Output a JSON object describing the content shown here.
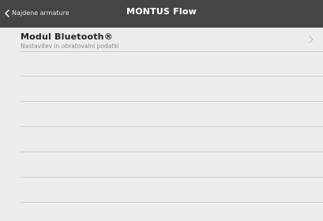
{
  "header": {
    "back_label": "Najdene armature",
    "title": "MONTUS Flow"
  },
  "list": {
    "items": [
      {
        "title": "Modul Bluetooth®",
        "subtitle": "Nastavitev in obratovalni podatki"
      }
    ],
    "empty_rows": 6
  },
  "colors": {
    "topbar": "#454545",
    "background": "#ededed",
    "separator": "#cfcfcf"
  },
  "icons": {
    "back": "chevron-left-icon",
    "row": "chevron-right-icon"
  }
}
